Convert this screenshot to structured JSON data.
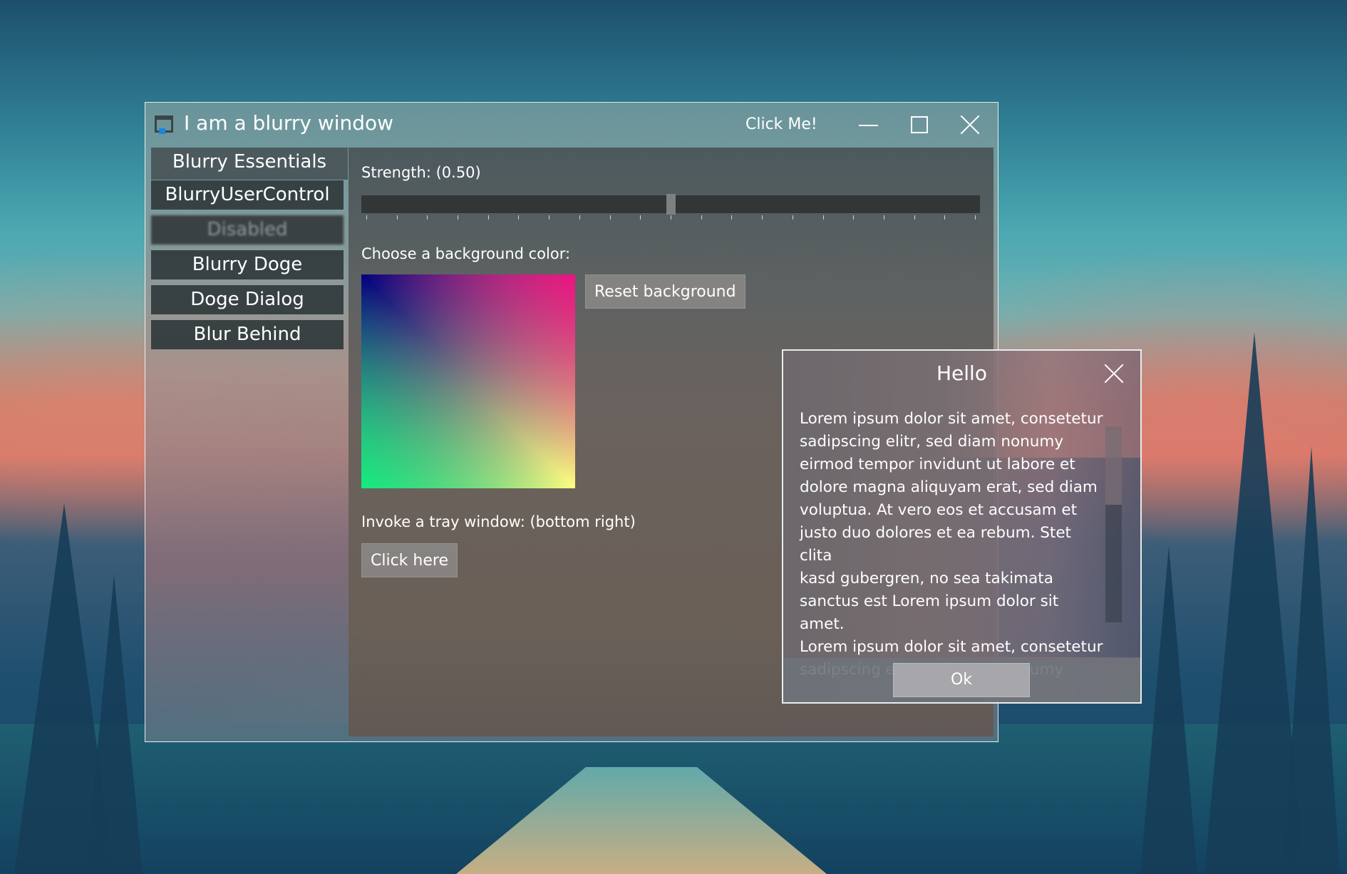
{
  "window": {
    "title": "I am a blurry window",
    "click_me_label": "Click Me!",
    "minimize_label": "Minimize",
    "maximize_label": "Maximize",
    "close_label": "Close"
  },
  "sidebar": {
    "tabs": [
      {
        "label": "Blurry Essentials",
        "selected": true,
        "enabled": true
      },
      {
        "label": "BlurryUserControl",
        "selected": false,
        "enabled": true
      },
      {
        "label": "Disabled",
        "selected": false,
        "enabled": false
      },
      {
        "label": "Blurry Doge",
        "selected": false,
        "enabled": true
      },
      {
        "label": "Doge Dialog",
        "selected": false,
        "enabled": true
      },
      {
        "label": "Blur Behind",
        "selected": false,
        "enabled": true
      }
    ]
  },
  "content": {
    "strength_label": "Strength: (0.50)",
    "strength_value": 0.5,
    "slider_min": 0,
    "slider_max": 1,
    "slider_tick_count": 21,
    "color_label": "Choose a background color:",
    "color_picker_corners": {
      "top_left": "#00007f",
      "top_right": "#ff0080",
      "bottom_left": "#00ff80",
      "bottom_right": "#ffff80"
    },
    "reset_button_label": "Reset background",
    "tray_label": "Invoke a tray window: (bottom right)",
    "click_here_label": "Click here"
  },
  "dialog": {
    "title": "Hello",
    "body": "Lorem ipsum dolor sit amet, consetetur\nsadipscing elitr, sed diam nonumy\neirmod tempor invidunt ut labore et\ndolore magna aliquyam erat, sed diam\nvoluptua. At vero eos et accusam et\njusto duo dolores et ea rebum. Stet clita\nkasd gubergren, no sea takimata\nsanctus est Lorem ipsum dolor sit amet.\nLorem ipsum dolor sit amet, consetetur\nsadipscing elitr, sed diam nonumy",
    "ok_label": "Ok",
    "scroll_position": 0,
    "scroll_visible_fraction": 0.4
  }
}
